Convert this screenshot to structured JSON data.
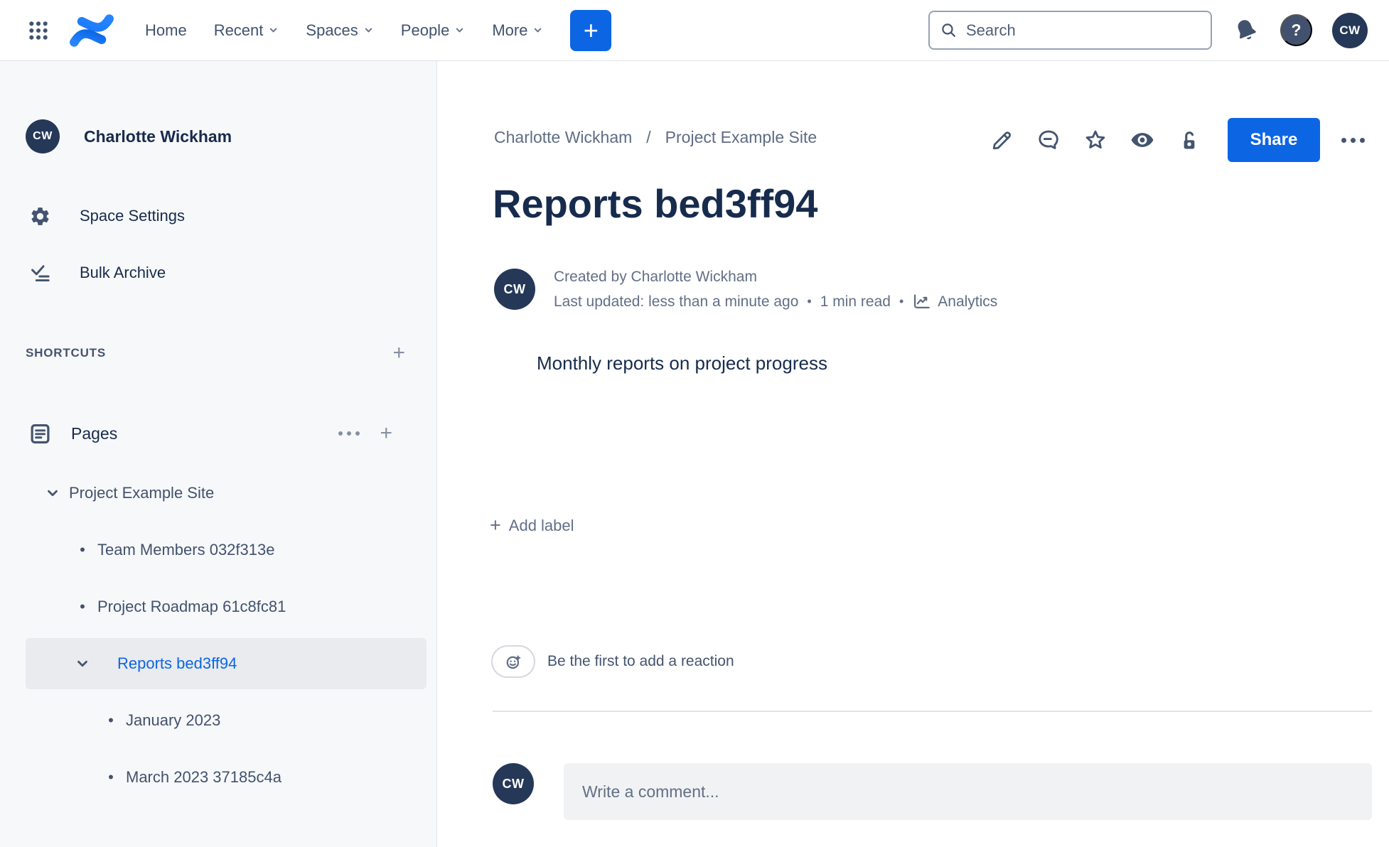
{
  "colors": {
    "accent_blue": "#0C66E4",
    "logo_blue_light": "#2684FF",
    "logo_blue_dark": "#0052CC",
    "text_primary": "#172B4D",
    "text_secondary": "#626F86",
    "icon_navy": "#44546F",
    "sidebar_bg": "#F7F8F9",
    "selected_item_bg": "#E9EBEF",
    "avatar_bg": "#253858",
    "comment_box_bg": "#F1F2F4"
  },
  "icons": {
    "bullet": "•",
    "plus": "+"
  },
  "topnav": {
    "menu": [
      {
        "label": "Home"
      },
      {
        "label": "Recent"
      },
      {
        "label": "Spaces"
      },
      {
        "label": "People"
      },
      {
        "label": "More"
      }
    ],
    "create_button": "+",
    "search_placeholder": "Search",
    "help": "?",
    "avatar_initials": "CW"
  },
  "sidebar": {
    "profile": {
      "initials": "CW",
      "name": "Charlotte Wickham"
    },
    "space_settings": "Space Settings",
    "bulk_archive": "Bulk Archive",
    "shortcuts_header": "SHORTCUTS",
    "pages_label": "Pages",
    "tree": [
      {
        "label": "Project Example Site"
      },
      {
        "label": "Team Members 032f313e"
      },
      {
        "label": "Project Roadmap 61c8fc81"
      },
      {
        "label": "Reports bed3ff94"
      },
      {
        "label": "January 2023"
      },
      {
        "label": "March 2023 37185c4a"
      }
    ]
  },
  "main": {
    "breadcrumb": {
      "part1": "Charlotte Wickham",
      "separator": "/",
      "part2": "Project Example Site"
    },
    "share_button": "Share",
    "page_title": "Reports bed3ff94",
    "byline": {
      "initials": "CW",
      "line1": "Created by Charlotte Wickham",
      "updated": "Last updated: less than a minute ago",
      "dot": "•",
      "read_time": "1 min read",
      "analytics_label": "Analytics"
    },
    "body_text": "Monthly reports on project progress",
    "add_label_text": "Add label",
    "reaction_text": "Be the first to add a reaction",
    "comment": {
      "initials": "CW",
      "placeholder": "Write a comment..."
    }
  }
}
